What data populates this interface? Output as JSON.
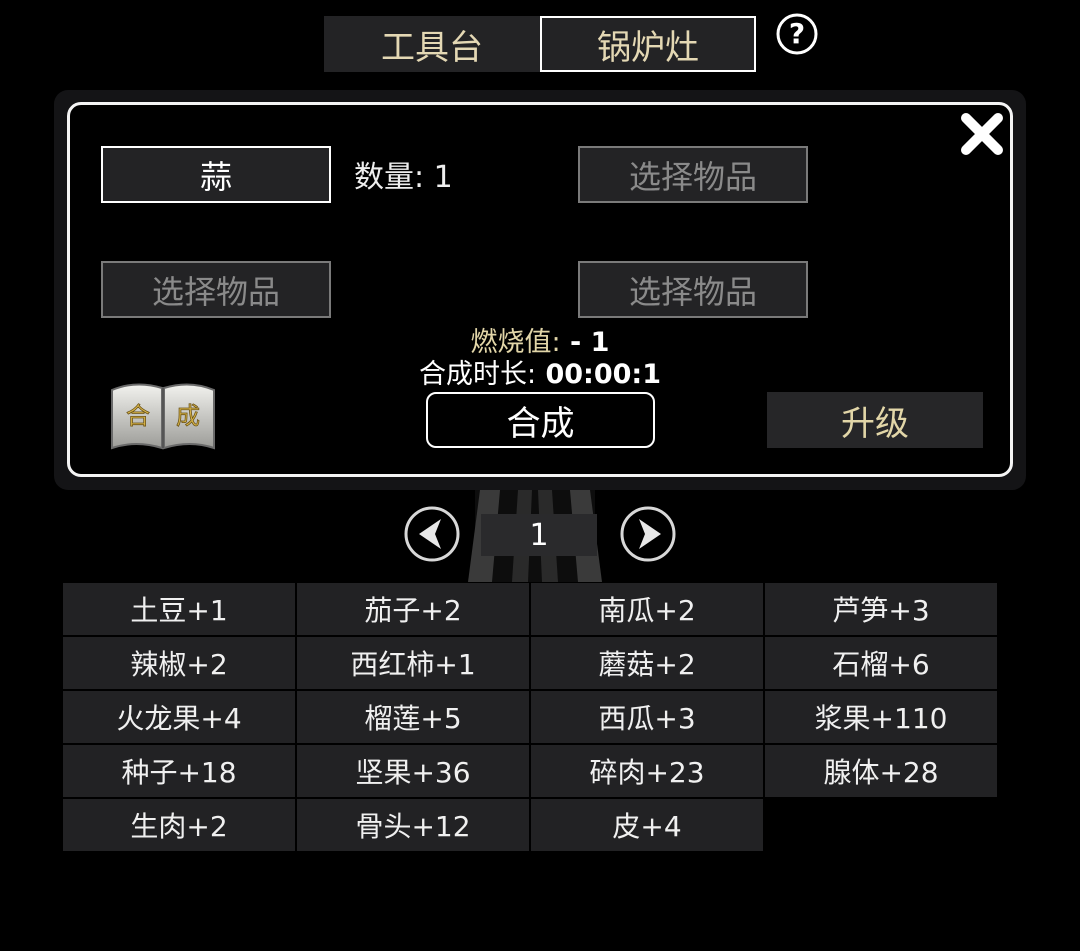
{
  "tabs": {
    "workbench": "工具台",
    "stove": "锅炉灶"
  },
  "slots": {
    "slot1": "蒜",
    "quantity": "数量: 1",
    "slot2": "选择物品",
    "slot3": "选择物品",
    "slot4": "选择物品"
  },
  "stats": {
    "burn_label": "燃烧值:",
    "burn_value": " - 1",
    "time_label": "合成时长:",
    "time_value": " 00:00:1"
  },
  "recipe_book_text": "合成",
  "buttons": {
    "craft": "合成",
    "upgrade": "升级"
  },
  "pagination": {
    "page": "1"
  },
  "items": [
    "土豆+1",
    "茄子+2",
    "南瓜+2",
    "芦笋+3",
    "辣椒+2",
    "西红柿+1",
    "蘑菇+2",
    "石榴+6",
    "火龙果+4",
    "榴莲+5",
    "西瓜+3",
    "浆果+110",
    "种子+18",
    "坚果+36",
    "碎肉+23",
    "腺体+28",
    "生肉+2",
    "骨头+12",
    "皮+4"
  ],
  "colors": {
    "gold_text": "#e2d6a8",
    "cell_bg": "#222224",
    "panel_border": "#f4f4f4"
  },
  "icons": {
    "help": "question-circle-icon",
    "close": "close-x-icon",
    "book": "recipe-book-icon",
    "prev": "arrow-left-circle-icon",
    "next": "arrow-right-circle-icon"
  }
}
